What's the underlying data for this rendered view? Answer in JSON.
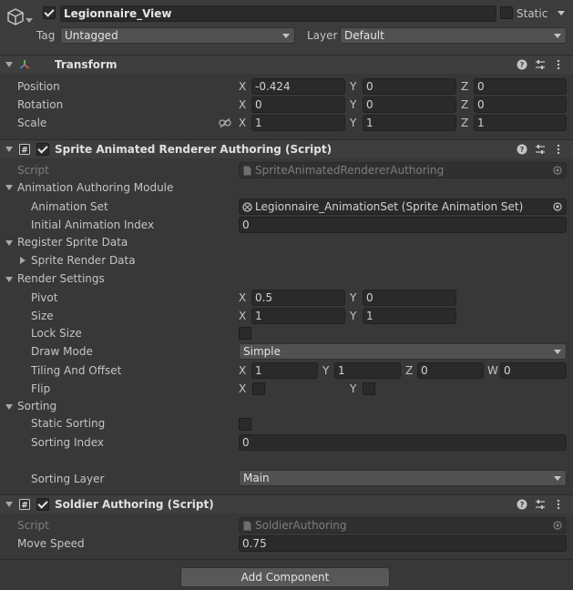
{
  "gameobject": {
    "name": "Legionnaire_View",
    "active": true,
    "static_label": "Static",
    "static_checked": false,
    "tag_label": "Tag",
    "tag_value": "Untagged",
    "layer_label": "Layer",
    "layer_value": "Default"
  },
  "transform": {
    "title": "Transform",
    "position_label": "Position",
    "rotation_label": "Rotation",
    "scale_label": "Scale",
    "axis_x": "X",
    "axis_y": "Y",
    "axis_z": "Z",
    "position": {
      "x": "-0.424",
      "y": "0",
      "z": "0"
    },
    "rotation": {
      "x": "0",
      "y": "0",
      "z": "0"
    },
    "scale": {
      "x": "1",
      "y": "1",
      "z": "1"
    }
  },
  "sprite_renderer": {
    "title": "Sprite Animated Renderer Authoring (Script)",
    "enabled": true,
    "script_label": "Script",
    "script_value": "SpriteAnimatedRendererAuthoring",
    "animation_module_label": "Animation Authoring Module",
    "animation_set_label": "Animation Set",
    "animation_set_value": "Legionnaire_AnimationSet (Sprite Animation Set)",
    "initial_index_label": "Initial Animation Index",
    "initial_index_value": "0",
    "register_label": "Register Sprite Data",
    "sprite_render_data_label": "Sprite Render Data",
    "render_settings_label": "Render Settings",
    "pivot_label": "Pivot",
    "pivot": {
      "x": "0.5",
      "y": "0"
    },
    "size_label": "Size",
    "size": {
      "x": "1",
      "y": "1"
    },
    "lock_size_label": "Lock Size",
    "lock_size": false,
    "draw_mode_label": "Draw Mode",
    "draw_mode_value": "Simple",
    "tiling_label": "Tiling And Offset",
    "tiling": {
      "x": "1",
      "y": "1",
      "z": "0",
      "w": "0"
    },
    "axis_w": "W",
    "flip_label": "Flip",
    "flip": {
      "x": false,
      "y": false
    },
    "sorting_label": "Sorting",
    "static_sorting_label": "Static Sorting",
    "static_sorting": false,
    "sorting_index_label": "Sorting Index",
    "sorting_index_value": "0",
    "sorting_layer_label": "Sorting Layer",
    "sorting_layer_value": "Main"
  },
  "soldier": {
    "title": "Soldier Authoring (Script)",
    "enabled": true,
    "script_label": "Script",
    "script_value": "SoldierAuthoring",
    "move_speed_label": "Move Speed",
    "move_speed_value": "0.75"
  },
  "add_component_label": "Add Component",
  "icons": {
    "gameobject": "cube-icon",
    "transform": "transform-axes-icon",
    "script": "csharp-script-icon",
    "help": "help-icon",
    "presets": "presets-icon",
    "menu": "kebab-menu-icon",
    "object_picker": "object-picker-icon",
    "constrain": "link-constrain-icon"
  },
  "colors": {
    "background": "#383838",
    "header": "#3e3e3e",
    "field": "#2a2a2a",
    "dropdown": "#515151"
  }
}
